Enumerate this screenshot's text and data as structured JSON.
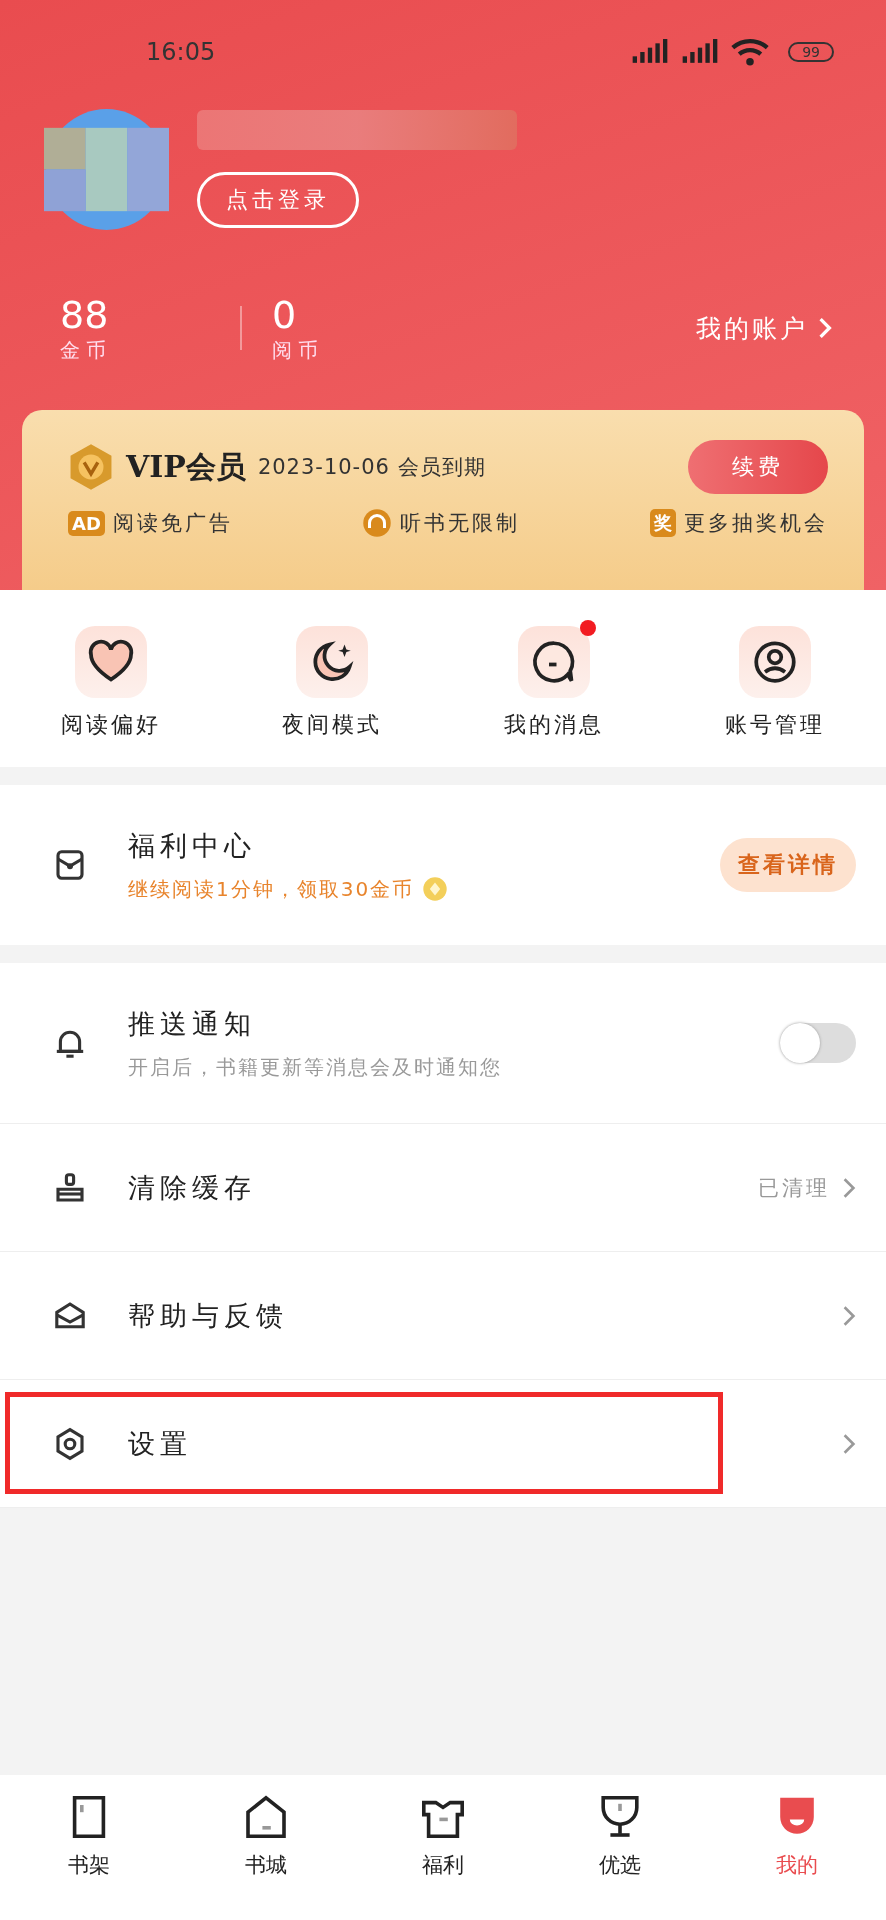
{
  "status_bar": {
    "time": "16:05",
    "battery": "99"
  },
  "profile": {
    "login_button": "点击登录",
    "stats": [
      {
        "value": "88",
        "label": "金币"
      },
      {
        "value": "0",
        "label": "阅币"
      }
    ],
    "account_link": "我的账户"
  },
  "vip": {
    "title": "VIP会员",
    "expiry": "2023-10-06 会员到期",
    "renew_button": "续费",
    "perks": [
      {
        "icon": "AD",
        "label": "阅读免广告",
        "kind": "badge"
      },
      {
        "label": "听书无限制",
        "kind": "headphones"
      },
      {
        "icon": "奖",
        "label": "更多抽奖机会",
        "kind": "badge"
      }
    ]
  },
  "shortcuts": [
    {
      "label": "阅读偏好",
      "kind": "heart",
      "unread": false
    },
    {
      "label": "夜间模式",
      "kind": "moon",
      "unread": false
    },
    {
      "label": "我的消息",
      "kind": "chat",
      "unread": true
    },
    {
      "label": "账号管理",
      "kind": "user",
      "unread": false
    }
  ],
  "welfare": {
    "title": "福利中心",
    "subtitle": "继续阅读1分钟，领取30金币",
    "button": "查看详情"
  },
  "settings": [
    {
      "kind": "toggle",
      "title": "推送通知",
      "subtitle": "开启后，书籍更新等消息会及时通知您",
      "on": false
    },
    {
      "kind": "link",
      "title": "清除缓存",
      "value": "已清理",
      "highlighted": false
    },
    {
      "kind": "link",
      "title": "帮助与反馈",
      "highlighted": false
    },
    {
      "kind": "link",
      "title": "设置",
      "highlighted": true
    }
  ],
  "tab_bar": [
    {
      "label": "书架",
      "selected": false
    },
    {
      "label": "书城",
      "selected": false
    },
    {
      "label": "福利",
      "selected": false
    },
    {
      "label": "优选",
      "selected": false
    },
    {
      "label": "我的",
      "selected": true
    }
  ]
}
